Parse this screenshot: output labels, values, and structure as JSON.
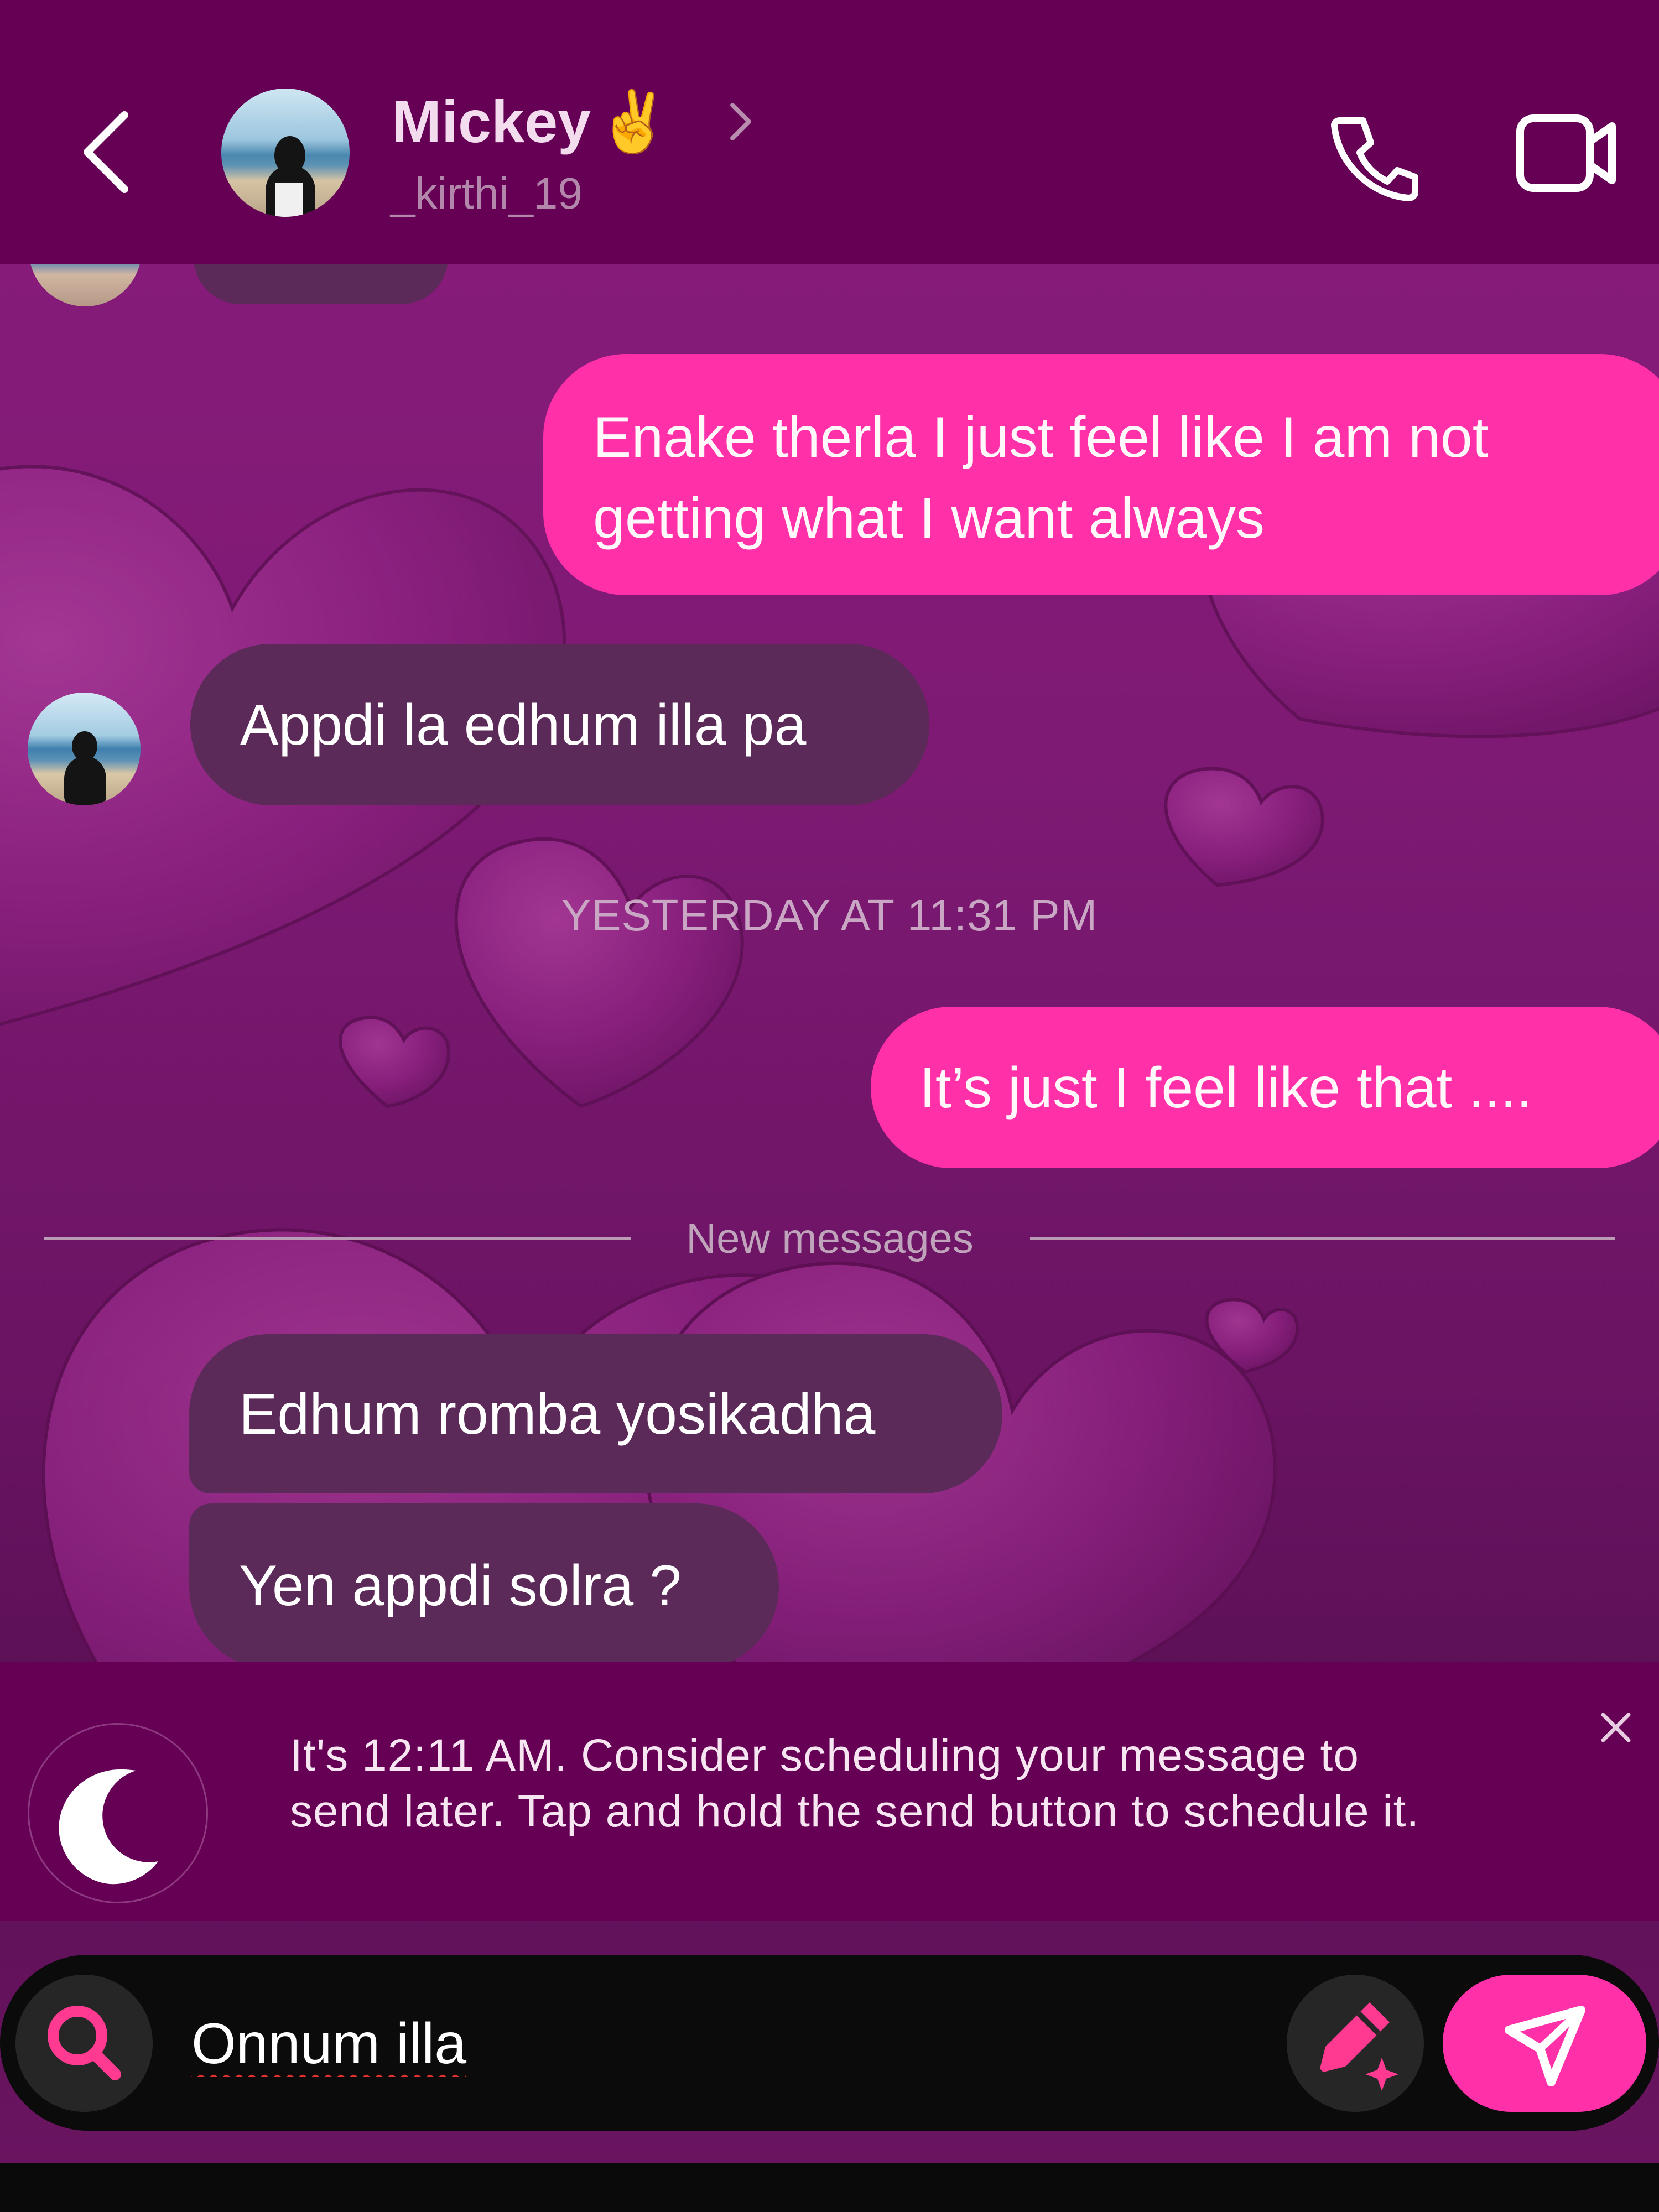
{
  "theme": {
    "header_bg": "#660055",
    "outgoing_bubble": "#ff30a8",
    "incoming_bubble": "#5b2a58",
    "send_button": "#ff30a8",
    "composer_bg": "#0b0b0b"
  },
  "header": {
    "back_icon": "chevron-left-icon",
    "contact_name": "Mickey",
    "contact_emoji": "✌️",
    "contact_handle": "_kirthi_19",
    "call_icon": "phone-icon",
    "video_icon": "video-camera-icon"
  },
  "messages": [
    {
      "direction": "outgoing",
      "lines": [
        "Enake therla I just feel like I am not",
        "getting what I want always"
      ]
    },
    {
      "direction": "incoming",
      "text": "Appdi la edhum illa pa"
    },
    {
      "direction": "outgoing",
      "text": "It’s just I feel like that ...."
    },
    {
      "direction": "incoming",
      "text": "Edhum romba yosikadha"
    },
    {
      "direction": "incoming",
      "text": "Yen appdi solra ?"
    }
  ],
  "timestamp": "YESTERDAY AT 11:31 PM",
  "divider": "New messages",
  "notice": {
    "icon": "moon-icon",
    "line1": "It's 12:11 AM. Consider scheduling your message to",
    "line2": "send later. Tap and hold the send button to schedule it.",
    "close_icon": "close-icon"
  },
  "composer": {
    "search_icon": "search-icon",
    "input_value": "Onnum illa",
    "sticker_icon": "pencil-sparkle-icon",
    "send_icon": "send-icon"
  }
}
